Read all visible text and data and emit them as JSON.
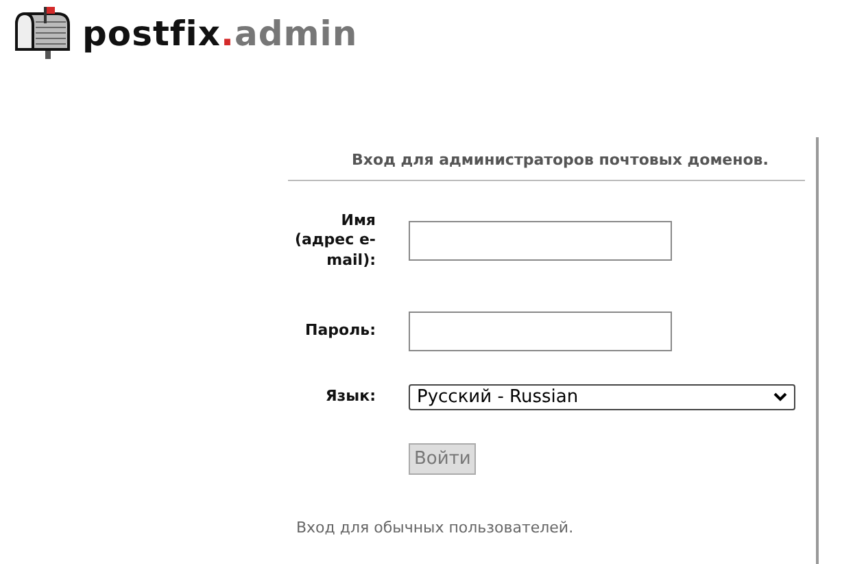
{
  "logo": {
    "parts": [
      "postfix",
      ".",
      "admin"
    ]
  },
  "login": {
    "title": "Вход для администраторов почтовых доменов.",
    "fields": [
      {
        "kind": "text",
        "label": "Имя (адрес e-mail):"
      },
      {
        "kind": "password",
        "label": "Пароль:"
      },
      {
        "kind": "select",
        "label": "Язык:",
        "value": "Русский - Russian"
      }
    ],
    "submit": {
      "label": "Войти",
      "disabled": true
    },
    "user_link": "Вход для обычных пользователей."
  }
}
